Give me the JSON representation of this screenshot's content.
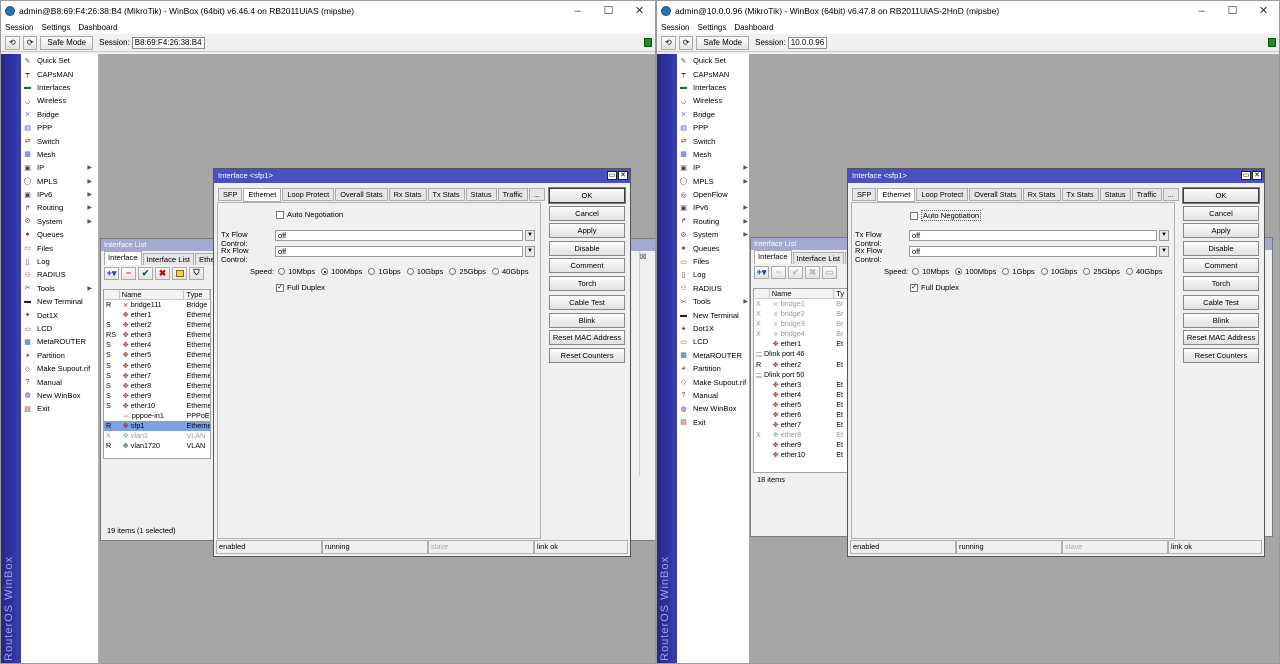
{
  "left": {
    "title": "admin@B8:69:F4:26:38:B4 (MikroTik) - WinBox (64bit) v6.46.4 on RB2011UiAS (mipsbe)",
    "menus": [
      "Session",
      "Settings",
      "Dashboard"
    ],
    "safe_mode": "Safe Mode",
    "session_label": "Session:",
    "session_value": "B8:69:F4:26:38:B4",
    "side_menu": [
      {
        "label": "Quick Set",
        "icon": "wand-icon",
        "arrow": false
      },
      {
        "label": "CAPsMAN",
        "icon": "capsman-icon",
        "arrow": false
      },
      {
        "label": "Interfaces",
        "icon": "interfaces-icon",
        "arrow": false
      },
      {
        "label": "Wireless",
        "icon": "wireless-icon",
        "arrow": false
      },
      {
        "label": "Bridge",
        "icon": "bridge-icon",
        "arrow": false
      },
      {
        "label": "PPP",
        "icon": "ppp-icon",
        "arrow": false
      },
      {
        "label": "Switch",
        "icon": "switch-icon",
        "arrow": false
      },
      {
        "label": "Mesh",
        "icon": "mesh-icon",
        "arrow": false
      },
      {
        "label": "IP",
        "icon": "ip-icon",
        "arrow": true
      },
      {
        "label": "MPLS",
        "icon": "mpls-icon",
        "arrow": true
      },
      {
        "label": "IPv6",
        "icon": "ipv6-icon",
        "arrow": true
      },
      {
        "label": "Routing",
        "icon": "routing-icon",
        "arrow": true
      },
      {
        "label": "System",
        "icon": "system-icon",
        "arrow": true
      },
      {
        "label": "Queues",
        "icon": "queues-icon",
        "arrow": false
      },
      {
        "label": "Files",
        "icon": "files-icon",
        "arrow": false
      },
      {
        "label": "Log",
        "icon": "log-icon",
        "arrow": false
      },
      {
        "label": "RADIUS",
        "icon": "radius-icon",
        "arrow": false
      },
      {
        "label": "Tools",
        "icon": "tools-icon",
        "arrow": true
      },
      {
        "label": "New Terminal",
        "icon": "terminal-icon",
        "arrow": false
      },
      {
        "label": "Dot1X",
        "icon": "dot1x-icon",
        "arrow": false
      },
      {
        "label": "LCD",
        "icon": "lcd-icon",
        "arrow": false
      },
      {
        "label": "MetaROUTER",
        "icon": "metarouter-icon",
        "arrow": false
      },
      {
        "label": "Partition",
        "icon": "partition-icon",
        "arrow": false
      },
      {
        "label": "Make Supout.rif",
        "icon": "supout-icon",
        "arrow": false
      },
      {
        "label": "Manual",
        "icon": "manual-icon",
        "arrow": false
      },
      {
        "label": "New WinBox",
        "icon": "winbox-icon",
        "arrow": false
      },
      {
        "label": "Exit",
        "icon": "exit-icon",
        "arrow": false
      }
    ],
    "brand": "RouterOS WinBox",
    "iface_list": {
      "title": "Interface List",
      "tabs": [
        "Interface",
        "Interface List",
        "Ether"
      ],
      "columns": [
        "Name",
        "Type"
      ],
      "rows": [
        {
          "flag": "R",
          "name": "bridge111",
          "type": "Bridge",
          "sel": false,
          "dis": false
        },
        {
          "flag": "",
          "name": "ether1",
          "type": "Etherne",
          "sel": false,
          "dis": false
        },
        {
          "flag": "S",
          "name": "ether2",
          "type": "Etherne",
          "sel": false,
          "dis": false
        },
        {
          "flag": "RS",
          "name": "ether3",
          "type": "Etherne",
          "sel": false,
          "dis": false
        },
        {
          "flag": "S",
          "name": "ether4",
          "type": "Etherne",
          "sel": false,
          "dis": false
        },
        {
          "flag": "S",
          "name": "ether5",
          "type": "Etherne",
          "sel": false,
          "dis": false
        },
        {
          "flag": "S",
          "name": "ether6",
          "type": "Etherne",
          "sel": false,
          "dis": false
        },
        {
          "flag": "S",
          "name": "ether7",
          "type": "Etherne",
          "sel": false,
          "dis": false
        },
        {
          "flag": "S",
          "name": "ether8",
          "type": "Etherne",
          "sel": false,
          "dis": false
        },
        {
          "flag": "S",
          "name": "ether9",
          "type": "Etherne",
          "sel": false,
          "dis": false
        },
        {
          "flag": "S",
          "name": "ether10",
          "type": "Etherne",
          "sel": false,
          "dis": false
        },
        {
          "flag": "",
          "name": "pppoe-in1",
          "type": "PPPoE",
          "sel": false,
          "dis": false
        },
        {
          "flag": "R",
          "name": "sfp1",
          "type": "Etherne",
          "sel": true,
          "dis": false
        },
        {
          "flag": "X",
          "name": "vlan1",
          "type": "VLAN",
          "sel": false,
          "dis": true
        },
        {
          "flag": "R",
          "name": "vlan1720",
          "type": "VLAN",
          "sel": false,
          "dis": false
        }
      ],
      "status": "19 items (1 selected)"
    },
    "dialog": {
      "title": "Interface <sfp1>",
      "tabs": [
        "SFP",
        "Ethernet",
        "Loop Protect",
        "Overall Stats",
        "Rx Stats",
        "Tx Stats",
        "Status",
        "Traffic",
        "..."
      ],
      "active_tab": 1,
      "auto_negotiation": "Auto Negotiation",
      "tx_flow_label": "Tx Flow Control:",
      "tx_flow_value": "off",
      "rx_flow_label": "Rx Flow Control:",
      "rx_flow_value": "off",
      "speed_label": "Speed:",
      "speeds": [
        "10Mbps",
        "100Mbps",
        "1Gbps",
        "10Gbps",
        "25Gbps",
        "40Gbps"
      ],
      "speed_selected": 1,
      "full_duplex": "Full Duplex",
      "buttons": [
        "OK",
        "Cancel",
        "Apply",
        "Disable",
        "Comment",
        "Torch",
        "Cable Test",
        "Blink",
        "Reset MAC Address",
        "Reset Counters"
      ],
      "status": [
        "enabled",
        "running",
        "slave",
        "link ok"
      ]
    }
  },
  "right": {
    "title": "admin@10.0.0.96 (MikroTik) - WinBox (64bit) v6.47.8 on RB2011UiAS-2HnD (mipsbe)",
    "menus": [
      "Session",
      "Settings",
      "Dashboard"
    ],
    "safe_mode": "Safe Mode",
    "session_label": "Session:",
    "session_value": "10.0.0.96",
    "side_menu": [
      {
        "label": "Quick Set",
        "icon": "wand-icon",
        "arrow": false
      },
      {
        "label": "CAPsMAN",
        "icon": "capsman-icon",
        "arrow": false
      },
      {
        "label": "Interfaces",
        "icon": "interfaces-icon",
        "arrow": false
      },
      {
        "label": "Wireless",
        "icon": "wireless-icon",
        "arrow": false
      },
      {
        "label": "Bridge",
        "icon": "bridge-icon",
        "arrow": false
      },
      {
        "label": "PPP",
        "icon": "ppp-icon",
        "arrow": false
      },
      {
        "label": "Switch",
        "icon": "switch-icon",
        "arrow": false
      },
      {
        "label": "Mesh",
        "icon": "mesh-icon",
        "arrow": false
      },
      {
        "label": "IP",
        "icon": "ip-icon",
        "arrow": true
      },
      {
        "label": "MPLS",
        "icon": "mpls-icon",
        "arrow": true
      },
      {
        "label": "OpenFlow",
        "icon": "openflow-icon",
        "arrow": false
      },
      {
        "label": "IPv6",
        "icon": "ipv6-icon",
        "arrow": true
      },
      {
        "label": "Routing",
        "icon": "routing-icon",
        "arrow": true
      },
      {
        "label": "System",
        "icon": "system-icon",
        "arrow": true
      },
      {
        "label": "Queues",
        "icon": "queues-icon",
        "arrow": false
      },
      {
        "label": "Files",
        "icon": "files-icon",
        "arrow": false
      },
      {
        "label": "Log",
        "icon": "log-icon",
        "arrow": false
      },
      {
        "label": "RADIUS",
        "icon": "radius-icon",
        "arrow": false
      },
      {
        "label": "Tools",
        "icon": "tools-icon",
        "arrow": true
      },
      {
        "label": "New Terminal",
        "icon": "terminal-icon",
        "arrow": false
      },
      {
        "label": "Dot1X",
        "icon": "dot1x-icon",
        "arrow": false
      },
      {
        "label": "LCD",
        "icon": "lcd-icon",
        "arrow": false
      },
      {
        "label": "MetaROUTER",
        "icon": "metarouter-icon",
        "arrow": false
      },
      {
        "label": "Partition",
        "icon": "partition-icon",
        "arrow": false
      },
      {
        "label": "Make Supout.rif",
        "icon": "supout-icon",
        "arrow": false
      },
      {
        "label": "Manual",
        "icon": "manual-icon",
        "arrow": false
      },
      {
        "label": "New WinBox",
        "icon": "winbox-icon",
        "arrow": false
      },
      {
        "label": "Exit",
        "icon": "exit-icon",
        "arrow": false
      }
    ],
    "brand": "RouterOS WinBox",
    "iface_list": {
      "title": "Interface List",
      "tabs": [
        "Interface",
        "Interface List",
        "E"
      ],
      "columns": [
        "Name",
        "Ty"
      ],
      "rows": [
        {
          "flag": "X",
          "name": "bridge1",
          "type": "Br",
          "sel": false,
          "dis": true
        },
        {
          "flag": "X",
          "name": "bridge2",
          "type": "Br",
          "sel": false,
          "dis": true
        },
        {
          "flag": "X",
          "name": "bridge3",
          "type": "Br",
          "sel": false,
          "dis": true
        },
        {
          "flag": "X",
          "name": "bridge4",
          "type": "Br",
          "sel": false,
          "dis": true
        },
        {
          "flag": "",
          "name": "ether1",
          "type": "Et",
          "sel": false,
          "dis": false
        },
        {
          "flag": "",
          "name": ";;; Dlink port 46",
          "type": "",
          "sel": false,
          "dis": false
        },
        {
          "flag": "R",
          "name": "ether2",
          "type": "Et",
          "sel": false,
          "dis": false
        },
        {
          "flag": "",
          "name": ";;; Dlink port 50",
          "type": "",
          "sel": false,
          "dis": false
        },
        {
          "flag": "",
          "name": "ether3",
          "type": "Et",
          "sel": false,
          "dis": false
        },
        {
          "flag": "",
          "name": "ether4",
          "type": "Et",
          "sel": false,
          "dis": false
        },
        {
          "flag": "",
          "name": "ether5",
          "type": "Et",
          "sel": false,
          "dis": false
        },
        {
          "flag": "",
          "name": "ether6",
          "type": "Et",
          "sel": false,
          "dis": false
        },
        {
          "flag": "",
          "name": "ether7",
          "type": "Et",
          "sel": false,
          "dis": false
        },
        {
          "flag": "X",
          "name": "ether8",
          "type": "Et",
          "sel": false,
          "dis": true
        },
        {
          "flag": "",
          "name": "ether9",
          "type": "Et",
          "sel": false,
          "dis": false
        },
        {
          "flag": "",
          "name": "ether10",
          "type": "Et",
          "sel": false,
          "dis": false
        }
      ],
      "status": "18 items"
    },
    "dialog": {
      "title": "Interface <sfp1>",
      "tabs": [
        "SFP",
        "Ethernet",
        "Loop Protect",
        "Overall Stats",
        "Rx Stats",
        "Tx Stats",
        "Status",
        "Traffic",
        "..."
      ],
      "active_tab": 1,
      "auto_negotiation": "Auto Negotiation",
      "tx_flow_label": "Tx Flow Control:",
      "tx_flow_value": "off",
      "rx_flow_label": "Rx Flow Control:",
      "rx_flow_value": "off",
      "speed_label": "Speed:",
      "speeds": [
        "10Mbps",
        "100Mbps",
        "1Gbps",
        "10Gbps",
        "25Gbps",
        "40Gbps"
      ],
      "speed_selected": 1,
      "full_duplex": "Full Duplex",
      "buttons": [
        "OK",
        "Cancel",
        "Apply",
        "Disable",
        "Comment",
        "Torch",
        "Cable Test",
        "Blink",
        "Reset MAC Address",
        "Reset Counters"
      ],
      "status": [
        "enabled",
        "running",
        "slave",
        "link ok"
      ]
    }
  },
  "colors": {
    "workarea": "#a6a6a6",
    "dialog_title": "#4a50c4",
    "list_title": "#a4a9cf",
    "selection": "#7aa2e0",
    "brand_strip": "#23268a"
  }
}
